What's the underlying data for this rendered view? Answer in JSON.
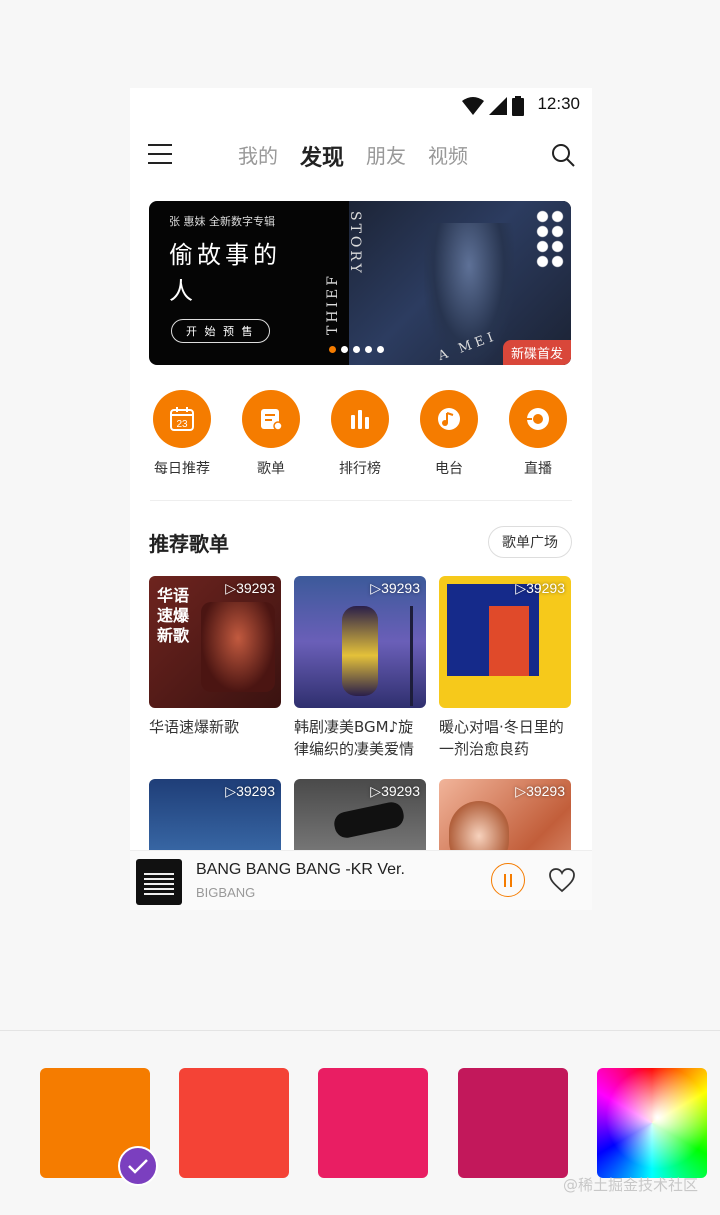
{
  "status_bar": {
    "time": "12:30"
  },
  "header": {
    "tabs": [
      {
        "label": "我的",
        "active": false
      },
      {
        "label": "发现",
        "active": true
      },
      {
        "label": "朋友",
        "active": false
      },
      {
        "label": "视频",
        "active": false
      }
    ]
  },
  "banner": {
    "artist": "张 惠妹  全新数字专辑",
    "title": "偷故事的人",
    "presale_label": "开 始 预 售",
    "vertical_text_1": "STORY",
    "vertical_text_2": "THIEF",
    "signature": "A MEI",
    "badge": "新碟首发",
    "page_count": 5,
    "active_page": 1
  },
  "quick_links": [
    {
      "label": "每日推荐",
      "icon": "calendar-icon",
      "number": "23"
    },
    {
      "label": "歌单",
      "icon": "playlist-icon"
    },
    {
      "label": "排行榜",
      "icon": "chart-bars-icon"
    },
    {
      "label": "电台",
      "icon": "radio-icon"
    },
    {
      "label": "直播",
      "icon": "live-icon"
    }
  ],
  "section": {
    "title": "推荐歌单",
    "more_label": "歌单广场"
  },
  "playlists": [
    {
      "name": "华语速爆新歌",
      "plays": "▷39293",
      "cover_text": "华语速爆新歌",
      "cover_color": "#5a1f1c"
    },
    {
      "name": "韩剧凄美BGM♪旋律编织的凄美爱情",
      "plays": "▷39293",
      "cover_color": "#4a3f8f"
    },
    {
      "name": "暖心对唱·冬日里的一剂治愈良药",
      "plays": "▷39293",
      "cover_color": "#f5c518"
    },
    {
      "name": "",
      "plays": "▷39293",
      "cover_color": "#2a4a7a"
    },
    {
      "name": "",
      "plays": "▷39293",
      "cover_color": "#6b6b6b"
    },
    {
      "name": "",
      "plays": "▷39293",
      "cover_color": "#c25e3a"
    }
  ],
  "player": {
    "song": "BANG BANG BANG -KR Ver.",
    "artist": "BIGBANG"
  },
  "palette": {
    "colors": [
      "#f57c00",
      "#f44336",
      "#e91e63",
      "#c2185b"
    ],
    "selected_index": 0
  },
  "watermark": "@稀土掘金技术社区"
}
